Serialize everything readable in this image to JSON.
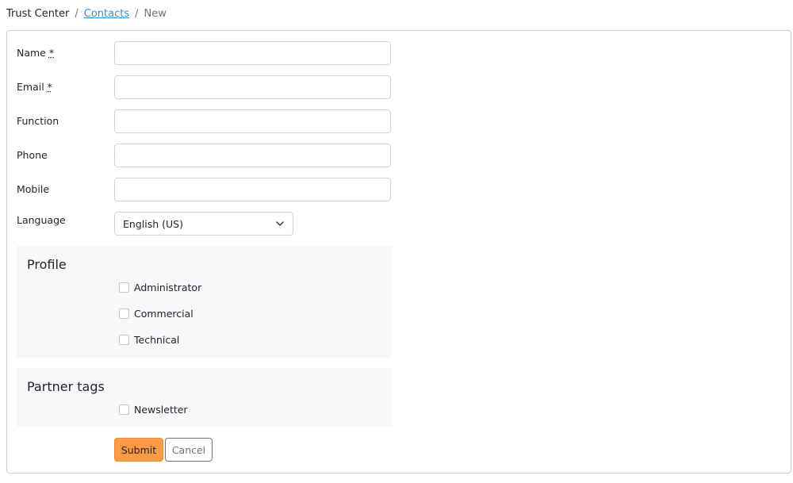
{
  "breadcrumb": {
    "root": "Trust Center",
    "separator": "/",
    "link": "Contacts",
    "current": "New"
  },
  "form": {
    "name": {
      "label": "Name",
      "required_marker": "*",
      "value": ""
    },
    "email": {
      "label": "Email",
      "required_marker": "*",
      "value": ""
    },
    "function": {
      "label": "Function",
      "value": ""
    },
    "phone": {
      "label": "Phone",
      "value": ""
    },
    "mobile": {
      "label": "Mobile",
      "value": ""
    },
    "language": {
      "label": "Language",
      "selected": "English (US)"
    }
  },
  "profile": {
    "title": "Profile",
    "options": [
      {
        "label": "Administrator",
        "checked": false
      },
      {
        "label": "Commercial",
        "checked": false
      },
      {
        "label": "Technical",
        "checked": false
      }
    ]
  },
  "partner_tags": {
    "title": "Partner tags",
    "options": [
      {
        "label": "Newsletter",
        "checked": false
      }
    ]
  },
  "actions": {
    "submit_label": "Submit",
    "cancel_label": "Cancel"
  },
  "colors": {
    "submit_bg": "#fd9a47",
    "link": "#3a8dcc",
    "fieldset_bg": "#f7f8fa"
  },
  "icons": {
    "select_chevron": "chevron-down-icon"
  }
}
